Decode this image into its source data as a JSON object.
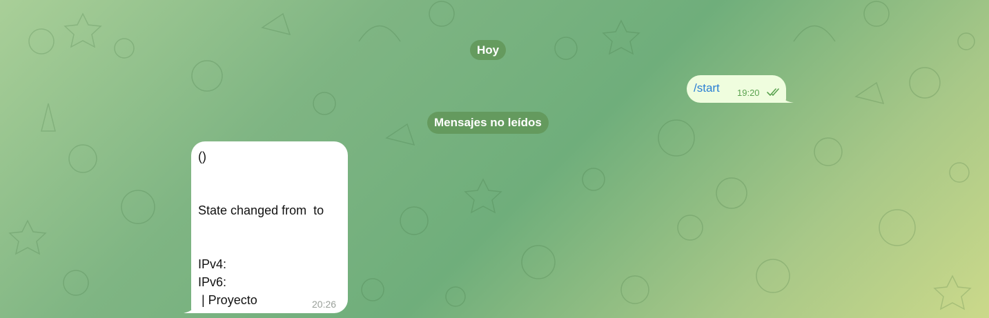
{
  "chat": {
    "date_separator": "Hoy",
    "unread_separator": "Mensajes no leídos"
  },
  "outgoing_message": {
    "text": "/start",
    "time": "19:20",
    "status_icon": "double-check-icon"
  },
  "incoming_message": {
    "text": "()\n\n\nState changed from  to\n\n\nIPv4:\nIPv6:\n | Proyecto",
    "time": "20:26"
  },
  "colors": {
    "outgoing_bubble": "#effdde",
    "outgoing_text": "#2a7fd4",
    "outgoing_meta": "#5aa250",
    "incoming_bubble": "#ffffff",
    "service_pill": "#629658"
  }
}
